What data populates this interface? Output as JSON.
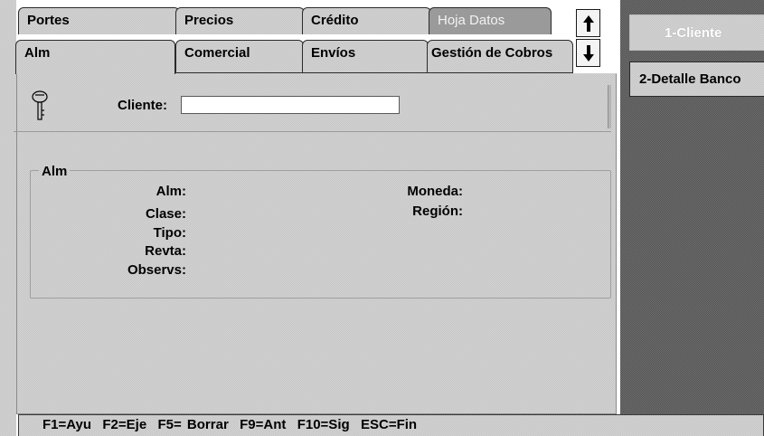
{
  "tabs_top": [
    {
      "label": "Portes"
    },
    {
      "label": "Precios"
    },
    {
      "label": "Crédito"
    },
    {
      "label": "Hoja Datos"
    }
  ],
  "tabs_bottom": [
    {
      "label": "Alm"
    },
    {
      "label": "Comercial"
    },
    {
      "label": "Envíos"
    },
    {
      "label": "Gestión de Cobros"
    }
  ],
  "scroll": {
    "up_icon": "arrow-up-icon",
    "down_icon": "arrow-down-icon"
  },
  "client": {
    "label": "Cliente:",
    "value": "",
    "key_icon": "key-icon"
  },
  "alm_group": {
    "title": "Alm",
    "left_fields": [
      "Alm:",
      "Clase:",
      "Tipo:",
      "Revta:",
      "Observs:"
    ],
    "right_fields": [
      "Moneda:",
      "Región:"
    ]
  },
  "side_buttons": [
    {
      "label": "1-Cliente",
      "enabled": false
    },
    {
      "label": "2-Detalle Banco",
      "enabled": true
    }
  ],
  "status_bar": {
    "text": "F1=Ayu  F2=Eje  F5= Borrar  F9=Ant  F10=Sig  ESC=Fin"
  },
  "colors": {
    "panel": "#d4d4d4",
    "side_panel": "#6f6f6f",
    "disabled_text": "#ffffff"
  }
}
